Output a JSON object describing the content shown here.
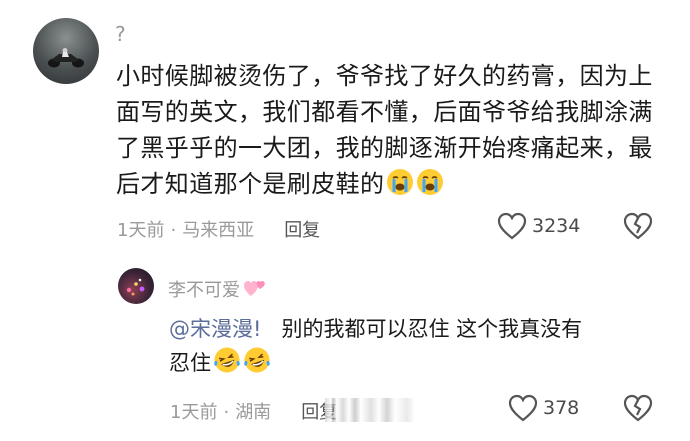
{
  "main_comment": {
    "username": "?",
    "text": "小时候脚被烫伤了，爷爷找了好久的药膏，因为上面写的英文，我们都看不懂，后面爷爷给我脚涂满了黑乎乎的一大团，我的脚逐渐开始疼痛起来，最后才知道那个是刷皮鞋的",
    "emojis": [
      "loudly-crying-emoji",
      "loudly-crying-emoji"
    ],
    "time": "1天前",
    "separator": "·",
    "location": "马来西亚",
    "reply_label": "回复",
    "like_count": "3234"
  },
  "reply_comment": {
    "username": "李不可爱",
    "username_emoji": "pink-hearts-emoji",
    "mention": "@宋漫漫!",
    "text_line1": "别的我都可以忍住 这个我真没有",
    "text_line2": "忍住",
    "emojis": [
      "laughing-crying-emoji",
      "laughing-crying-emoji"
    ],
    "time": "1天前",
    "separator": "·",
    "location": "湖南",
    "reply_label": "回复",
    "like_count": "378"
  },
  "icons": {
    "like": "heart-outline-icon",
    "dislike": "broken-heart-outline-icon"
  },
  "colors": {
    "mention": "#5b6e99",
    "meta": "#9a9a9a",
    "text": "#1a1a1a"
  }
}
